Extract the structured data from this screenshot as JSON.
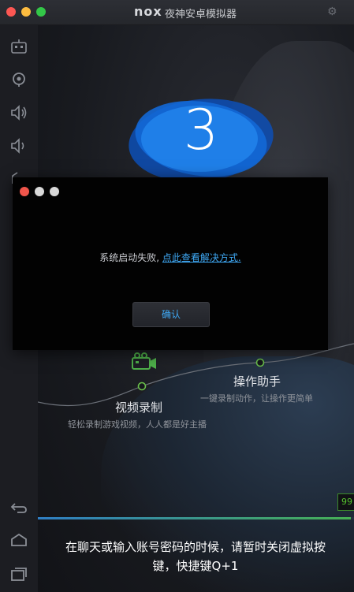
{
  "window": {
    "logo": "nox",
    "title": "夜神安卓模拟器",
    "settings_icon": "gear-icon",
    "traffic_light_colors": [
      "#fc5753",
      "#fdbc40",
      "#33c748"
    ]
  },
  "sidebar": {
    "items": [
      {
        "icon": "keyboard-icon"
      },
      {
        "icon": "location-icon"
      },
      {
        "icon": "volume-up-icon"
      },
      {
        "icon": "volume-down-icon"
      },
      {
        "icon": "more-tools-icon"
      }
    ],
    "bottom_items": [
      {
        "icon": "back-icon"
      },
      {
        "icon": "home-icon"
      },
      {
        "icon": "recent-apps-icon"
      }
    ]
  },
  "main": {
    "countdown": "3",
    "features": [
      {
        "title": "视频录制",
        "description": "轻松录制游戏视频，人人都是好主播",
        "icon": "video-camera-icon"
      },
      {
        "title": "操作助手",
        "description": "一键录制动作，让操作更简单"
      }
    ],
    "speed_badge": "99",
    "progress_fraction": 0.99,
    "tip": "在聊天或输入账号密码的时候，请暂时关闭虚拟按键，快捷键Q+1",
    "accent_color": "#3fa9f5"
  },
  "dialog": {
    "message": "系统启动失败,",
    "link_text": "点此查看解决方式.",
    "ok_label": "确认"
  }
}
